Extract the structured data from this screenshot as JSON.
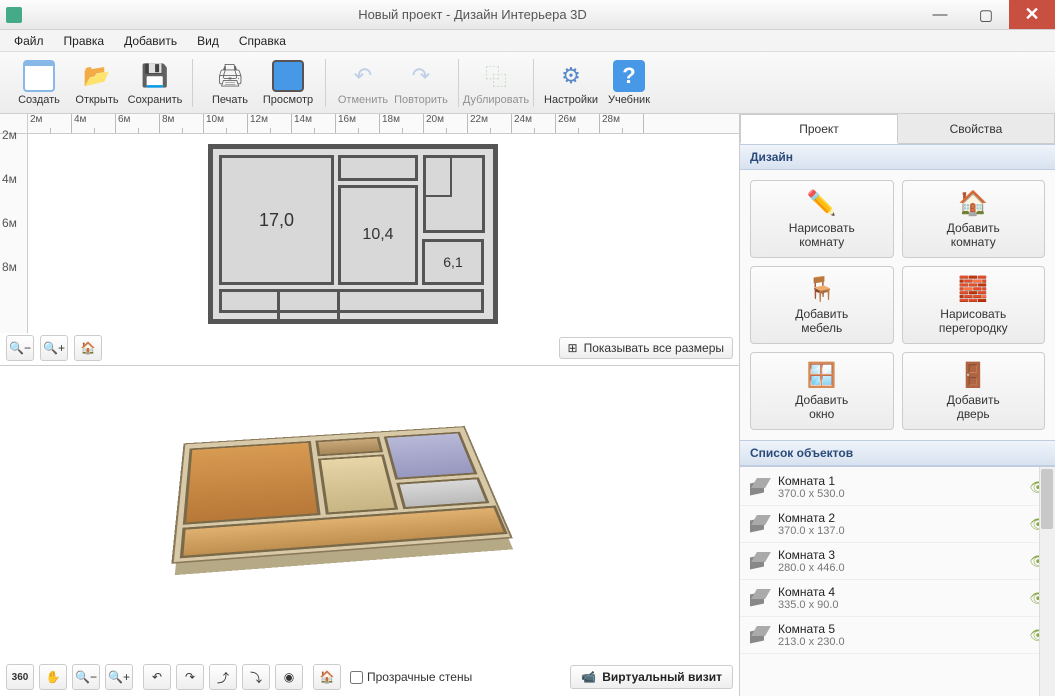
{
  "window": {
    "title": "Новый проект - Дизайн Интерьера 3D"
  },
  "menu": {
    "file": "Файл",
    "edit": "Правка",
    "add": "Добавить",
    "view": "Вид",
    "help": "Справка"
  },
  "toolbar": {
    "create": "Создать",
    "open": "Открыть",
    "save": "Сохранить",
    "print": "Печать",
    "preview": "Просмотр",
    "undo": "Отменить",
    "redo": "Повторить",
    "duplicate": "Дублировать",
    "settings": "Настройки",
    "tutorial": "Учебник"
  },
  "ruler_h": [
    "2м",
    "4м",
    "6м",
    "8м",
    "10м",
    "12м",
    "14м",
    "16м",
    "18м",
    "20м",
    "22м",
    "24м",
    "26м",
    "28м"
  ],
  "ruler_v": [
    "2м",
    "4м",
    "6м",
    "8м"
  ],
  "rooms_2d": {
    "r1": "17,0",
    "r2": "10,4",
    "r3": "6,1"
  },
  "view2d": {
    "show_dimensions": "Показывать все размеры"
  },
  "view3d": {
    "transparent_walls": "Прозрачные стены",
    "virtual_visit": "Виртуальный визит"
  },
  "tabs": {
    "project": "Проект",
    "properties": "Свойства"
  },
  "sections": {
    "design": "Дизайн",
    "objects": "Список объектов"
  },
  "design_btns": {
    "draw_room": "Нарисовать\nкомнату",
    "add_room": "Добавить\nкомнату",
    "add_furniture": "Добавить\nмебель",
    "draw_partition": "Нарисовать\nперегородку",
    "add_window": "Добавить\nокно",
    "add_door": "Добавить\nдверь"
  },
  "objects": [
    {
      "name": "Комната 1",
      "dim": "370.0 x 530.0"
    },
    {
      "name": "Комната 2",
      "dim": "370.0 x 137.0"
    },
    {
      "name": "Комната 3",
      "dim": "280.0 x 446.0"
    },
    {
      "name": "Комната 4",
      "dim": "335.0 x 90.0"
    },
    {
      "name": "Комната 5",
      "dim": "213.0 x 230.0"
    }
  ]
}
